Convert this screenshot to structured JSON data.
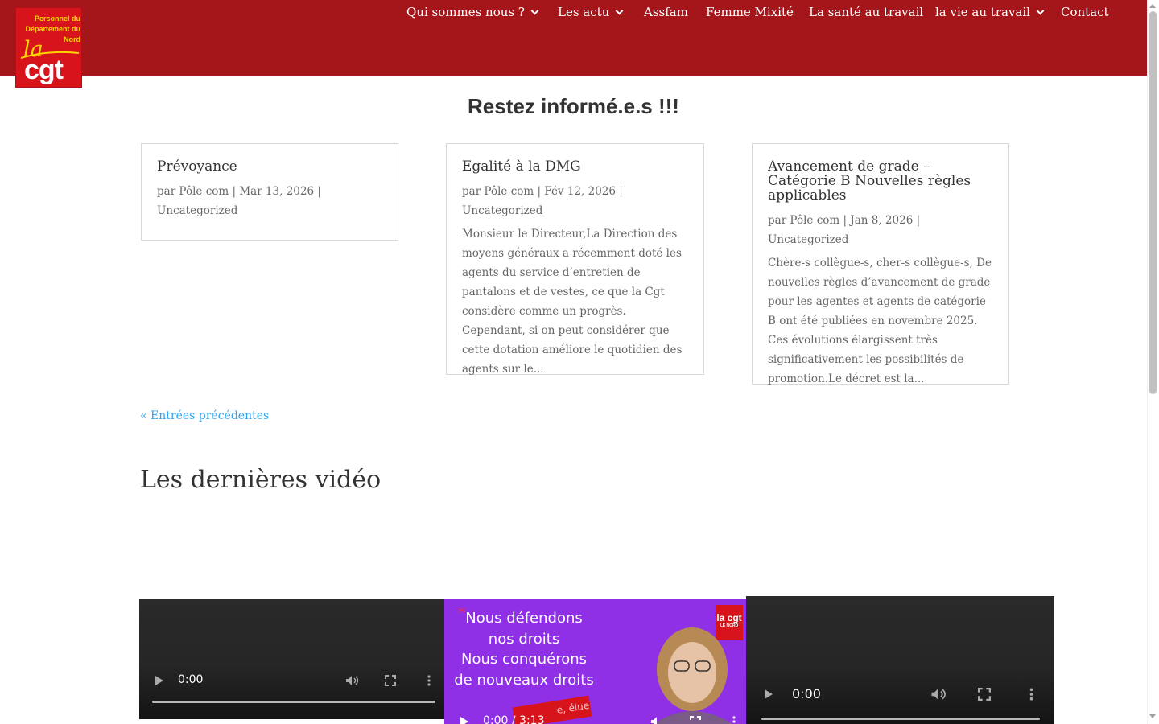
{
  "logo": {
    "line1": "Personnel du",
    "line2": "Département du",
    "line3": "Nord",
    "la": "la",
    "cgt": "cgt"
  },
  "nav": [
    {
      "label": "Qui sommes nous ?",
      "has_dropdown": true
    },
    {
      "label": "Les actu",
      "has_dropdown": true
    },
    {
      "label": "Assfam",
      "has_dropdown": false
    },
    {
      "label": "Femme Mixité",
      "has_dropdown": false
    },
    {
      "label": "La santé au travail",
      "has_dropdown": false
    },
    {
      "label": "la vie au travail",
      "has_dropdown": true
    },
    {
      "label": "Contact",
      "has_dropdown": false
    }
  ],
  "section_title": "Restez informé.e.s !!!",
  "posts": [
    {
      "title": "Prévoyance",
      "meta": "par Pôle com | Mar 13, 2026 | Uncategorized",
      "excerpt": ""
    },
    {
      "title": "Egalité à la DMG",
      "meta": "par Pôle com | Fév 12, 2026 | Uncategorized",
      "excerpt": "Monsieur le Directeur,La Direction des moyens généraux a récemment doté les agents du service d’entretien de pantalons et de vestes, ce que la Cgt considère comme un progrès. Cependant, si on peut considérer que cette dotation améliore le quotidien des agents sur le..."
    },
    {
      "title": "Avancement de grade – Catégorie B Nouvelles règles applicables",
      "meta": "par Pôle com | Jan 8, 2026 | Uncategorized",
      "excerpt": "Chère-s collègue-s, cher-s collègue-s, De nouvelles règles d’avancement de grade pour les agentes et agents de catégorie B ont été publiées en novembre 2025. Ces évolutions élargissent très significativement les possibilités de promotion.Le décret est la..."
    }
  ],
  "pagination": {
    "previous": "« Entrées précédentes"
  },
  "videos": {
    "heading": "Les dernières vidéo",
    "players": [
      {
        "time": "0:00"
      },
      {
        "time": "0:00 / 3:13",
        "thumbnail_lines": [
          "Nous défendons",
          "nos droits",
          "Nous conquérons",
          "de nouveaux droits"
        ],
        "star": "*",
        "badge": "la cgt",
        "badge_sub": "LE NORD",
        "ribbon": "e, élue"
      },
      {
        "time": "0:00"
      }
    ]
  },
  "colors": {
    "header_bg": "#a4161a",
    "logo_red": "#d7141b",
    "logo_yellow": "#ffd400",
    "link": "#2ea3f2",
    "thumbnail_purple": "#8f2fe6"
  },
  "icons": [
    "chevron-down-icon",
    "play-icon",
    "volume-icon",
    "fullscreen-icon",
    "more-options-icon"
  ]
}
